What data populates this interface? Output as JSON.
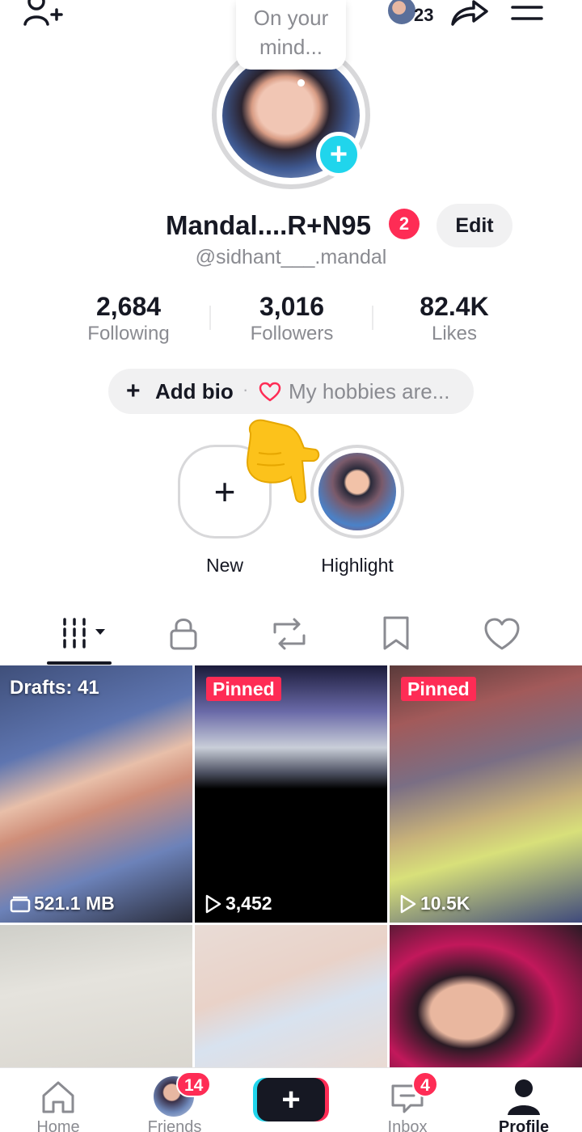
{
  "colors": {
    "accent_red": "#fe2c55",
    "accent_cyan": "#20d5ec",
    "text": "#161823",
    "muted": "#8a8b91"
  },
  "header": {
    "add_user_icon": "add-user-icon",
    "following_avatars_count": "23",
    "share_icon": "share-icon",
    "menu_icon": "menu-icon"
  },
  "profile": {
    "thought_bubble": "On your mind...",
    "avatar_add_label": "+",
    "display_name": "Mandal....R+N95",
    "name_badge": "2",
    "edit_label": "Edit",
    "username": "@sidhant___.mandal"
  },
  "stats": [
    {
      "value": "2,684",
      "label": "Following"
    },
    {
      "value": "3,016",
      "label": "Followers"
    },
    {
      "value": "82.4K",
      "label": "Likes"
    }
  ],
  "bio": {
    "plus": "+",
    "add_label": "Add bio",
    "separator": "·",
    "hint": "My hobbies are..."
  },
  "highlights": {
    "new_plus": "+",
    "new_label": "New",
    "highlight_label": "Highlight"
  },
  "tabs": [
    {
      "icon": "grid-dropdown-icon"
    },
    {
      "icon": "lock-icon"
    },
    {
      "icon": "repost-icon"
    },
    {
      "icon": "bookmark-icon"
    },
    {
      "icon": "heart-icon"
    }
  ],
  "videos": [
    {
      "label": "Drafts: 41",
      "stat": "521.1 MB"
    },
    {
      "badge": "Pinned",
      "stat": "3,452"
    },
    {
      "badge": "Pinned",
      "stat": "10.5K"
    },
    {},
    {},
    {}
  ],
  "nav": {
    "home": "Home",
    "friends": "Friends",
    "friends_badge": "14",
    "create": "+",
    "inbox": "Inbox",
    "inbox_badge": "4",
    "profile": "Profile"
  }
}
